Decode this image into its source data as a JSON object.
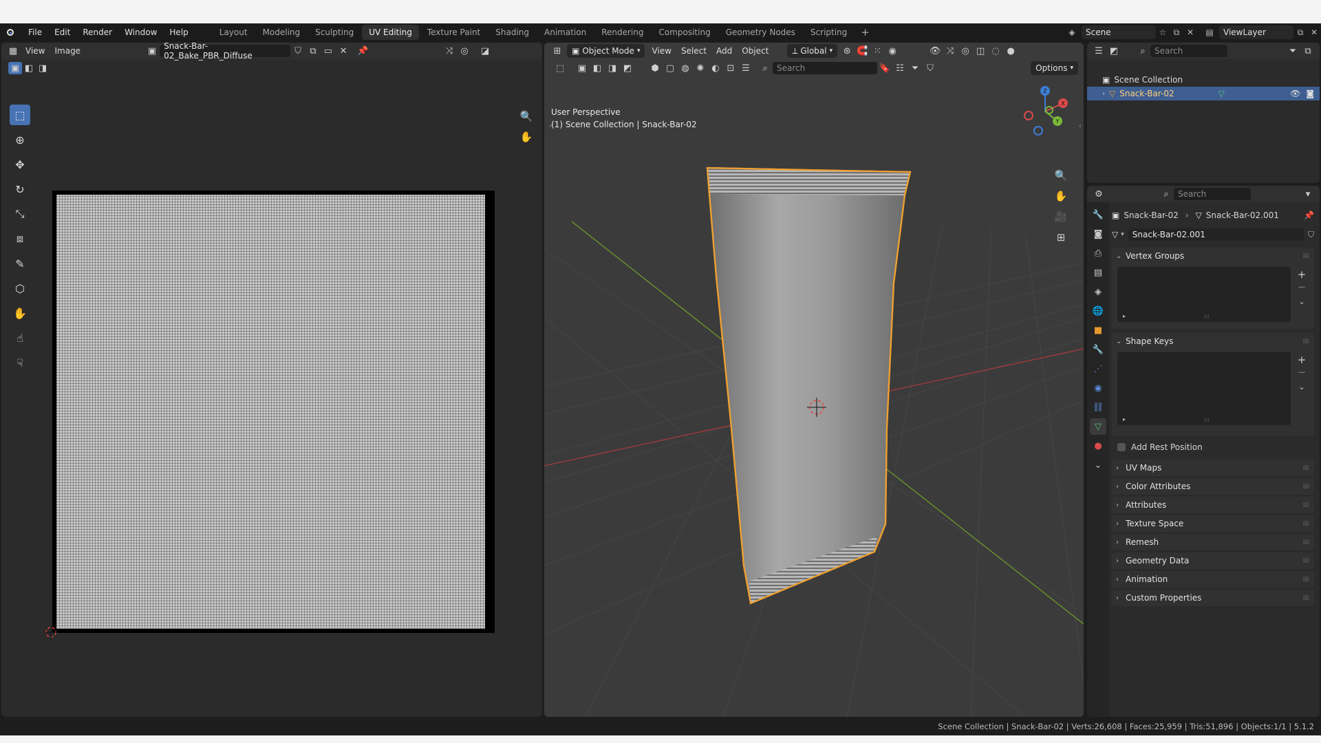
{
  "menu": [
    "File",
    "Edit",
    "Render",
    "Window",
    "Help"
  ],
  "workspaces": {
    "tabs": [
      "Layout",
      "Modeling",
      "Sculpting",
      "UV Editing",
      "Texture Paint",
      "Shading",
      "Animation",
      "Rendering",
      "Compositing",
      "Geometry Nodes",
      "Scripting"
    ],
    "active": "UV Editing",
    "add": "+"
  },
  "topbar_right": {
    "scene": "Scene",
    "view_layer": "ViewLayer"
  },
  "uv_editor": {
    "menus": [
      "View",
      "Image"
    ],
    "image_name": "Snack-Bar-02_Bake_PBR_Diffuse"
  },
  "viewport": {
    "mode": "Object Mode",
    "menus": [
      "View",
      "Select",
      "Add",
      "Object"
    ],
    "transform": "Global",
    "search_placeholder": "Search",
    "options": "Options",
    "perspective": "User Perspective",
    "collection_path": "(1) Scene Collection | Snack-Bar-02",
    "gizmo": {
      "x": "X",
      "y": "Y",
      "z": "Z"
    }
  },
  "outliner": {
    "search_placeholder": "Search",
    "root": "Scene Collection",
    "object": "Snack-Bar-02"
  },
  "properties": {
    "search_placeholder": "Search",
    "breadcrumb_object": "Snack-Bar-02",
    "breadcrumb_mesh": "Snack-Bar-02.001",
    "mesh_name": "Snack-Bar-02.001",
    "vertex_groups": "Vertex Groups",
    "shape_keys": "Shape Keys",
    "add_rest_position": "Add Rest Position",
    "collapsed_panels": [
      "UV Maps",
      "Color Attributes",
      "Attributes",
      "Texture Space",
      "Remesh",
      "Geometry Data",
      "Animation",
      "Custom Properties"
    ]
  },
  "statusbar": "Scene Collection | Snack-Bar-02 | Verts:26,608 | Faces:25,959 | Tris:51,896 | Objects:1/1 | 5.1.2"
}
